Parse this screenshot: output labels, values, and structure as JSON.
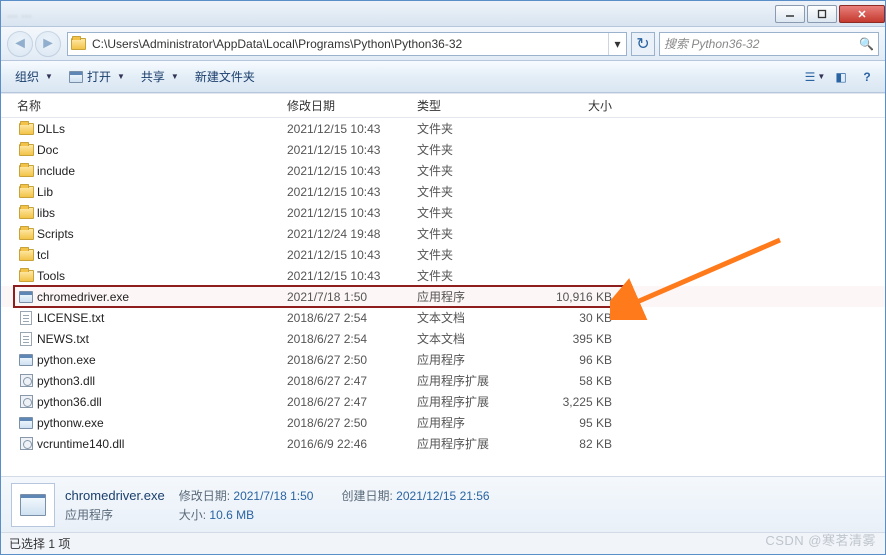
{
  "titlebar": {
    "blurred_tabs": "… …"
  },
  "nav": {
    "path": "C:\\Users\\Administrator\\AppData\\Local\\Programs\\Python\\Python36-32",
    "search_placeholder": "搜索 Python36-32"
  },
  "toolbar": {
    "organize": "组织",
    "open": "打开",
    "share": "共享",
    "new_folder": "新建文件夹"
  },
  "columns": {
    "name": "名称",
    "date": "修改日期",
    "type": "类型",
    "size": "大小"
  },
  "files": [
    {
      "icon": "folder",
      "name": "DLLs",
      "date": "2021/12/15 10:43",
      "type": "文件夹",
      "size": ""
    },
    {
      "icon": "folder",
      "name": "Doc",
      "date": "2021/12/15 10:43",
      "type": "文件夹",
      "size": ""
    },
    {
      "icon": "folder",
      "name": "include",
      "date": "2021/12/15 10:43",
      "type": "文件夹",
      "size": ""
    },
    {
      "icon": "folder",
      "name": "Lib",
      "date": "2021/12/15 10:43",
      "type": "文件夹",
      "size": ""
    },
    {
      "icon": "folder",
      "name": "libs",
      "date": "2021/12/15 10:43",
      "type": "文件夹",
      "size": ""
    },
    {
      "icon": "folder",
      "name": "Scripts",
      "date": "2021/12/24 19:48",
      "type": "文件夹",
      "size": ""
    },
    {
      "icon": "folder",
      "name": "tcl",
      "date": "2021/12/15 10:43",
      "type": "文件夹",
      "size": ""
    },
    {
      "icon": "folder",
      "name": "Tools",
      "date": "2021/12/15 10:43",
      "type": "文件夹",
      "size": ""
    },
    {
      "icon": "exe",
      "name": "chromedriver.exe",
      "date": "2021/7/18 1:50",
      "type": "应用程序",
      "size": "10,916 KB",
      "highlight": true
    },
    {
      "icon": "txt",
      "name": "LICENSE.txt",
      "date": "2018/6/27 2:54",
      "type": "文本文档",
      "size": "30 KB"
    },
    {
      "icon": "txt",
      "name": "NEWS.txt",
      "date": "2018/6/27 2:54",
      "type": "文本文档",
      "size": "395 KB"
    },
    {
      "icon": "exe",
      "name": "python.exe",
      "date": "2018/6/27 2:50",
      "type": "应用程序",
      "size": "96 KB"
    },
    {
      "icon": "dll",
      "name": "python3.dll",
      "date": "2018/6/27 2:47",
      "type": "应用程序扩展",
      "size": "58 KB"
    },
    {
      "icon": "dll",
      "name": "python36.dll",
      "date": "2018/6/27 2:47",
      "type": "应用程序扩展",
      "size": "3,225 KB"
    },
    {
      "icon": "exe",
      "name": "pythonw.exe",
      "date": "2018/6/27 2:50",
      "type": "应用程序",
      "size": "95 KB"
    },
    {
      "icon": "dll",
      "name": "vcruntime140.dll",
      "date": "2016/6/9 22:46",
      "type": "应用程序扩展",
      "size": "82 KB"
    }
  ],
  "details": {
    "filename": "chromedriver.exe",
    "filetype": "应用程序",
    "mod_label": "修改日期:",
    "mod_value": "2021/7/18 1:50",
    "size_label": "大小:",
    "size_value": "10.6 MB",
    "created_label": "创建日期:",
    "created_value": "2021/12/15 21:56"
  },
  "status": {
    "text": "已选择 1 项"
  },
  "watermark": "CSDN @寒茗清雾"
}
